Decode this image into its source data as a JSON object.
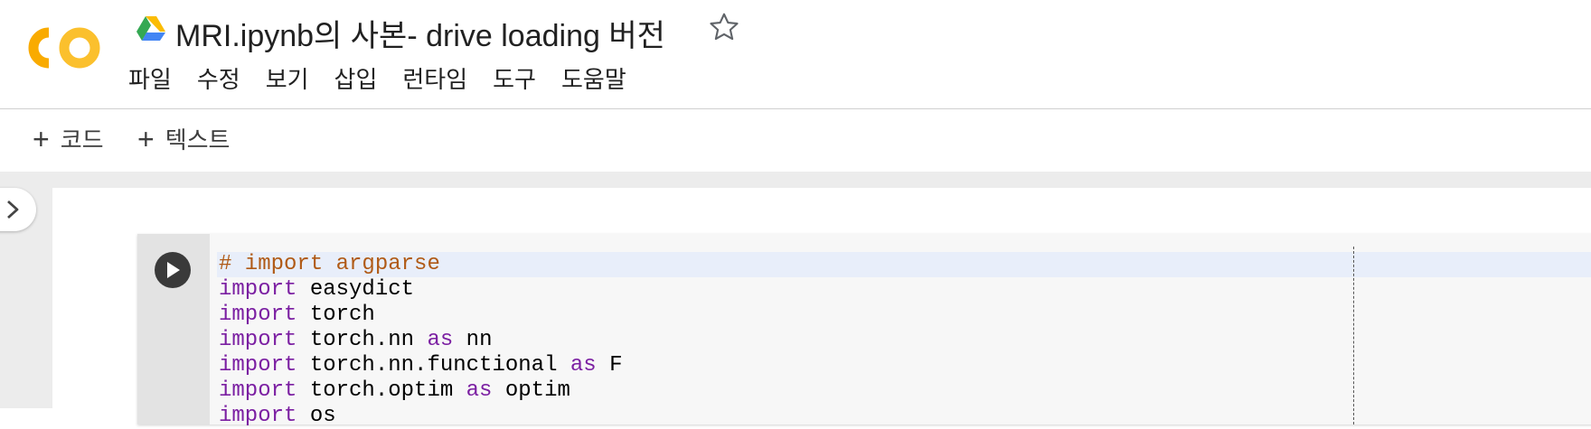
{
  "app": {
    "title": "MRI.ipynb의 사본- drive loading 버전",
    "logo_icon": "colab-logo-icon",
    "drive_icon": "google-drive-icon",
    "star_icon": "star-outline-icon"
  },
  "menu": {
    "items": [
      "파일",
      "수정",
      "보기",
      "삽입",
      "런타임",
      "도구",
      "도움말"
    ]
  },
  "toolbar": {
    "add_code_label": "코드",
    "add_text_label": "텍스트",
    "plus_glyph": "+"
  },
  "cell": {
    "run_icon": "play-icon",
    "lines": [
      {
        "segments": [
          {
            "t": "# import argparse",
            "c": "comment"
          }
        ],
        "active": true
      },
      {
        "segments": [
          {
            "t": "import",
            "c": "kw"
          },
          {
            "t": " easydict",
            "c": ""
          }
        ]
      },
      {
        "segments": [
          {
            "t": "import",
            "c": "kw"
          },
          {
            "t": " torch",
            "c": ""
          }
        ]
      },
      {
        "segments": [
          {
            "t": "import",
            "c": "kw"
          },
          {
            "t": " torch.nn ",
            "c": ""
          },
          {
            "t": "as",
            "c": "kw"
          },
          {
            "t": " nn",
            "c": ""
          }
        ]
      },
      {
        "segments": [
          {
            "t": "import",
            "c": "kw"
          },
          {
            "t": " torch.nn.functional ",
            "c": ""
          },
          {
            "t": "as",
            "c": "kw"
          },
          {
            "t": " F",
            "c": ""
          }
        ]
      },
      {
        "segments": [
          {
            "t": "import",
            "c": "kw"
          },
          {
            "t": " torch.optim ",
            "c": ""
          },
          {
            "t": "as",
            "c": "kw"
          },
          {
            "t": " optim",
            "c": ""
          }
        ]
      },
      {
        "segments": [
          {
            "t": "import",
            "c": "kw"
          },
          {
            "t": " os",
            "c": ""
          }
        ]
      }
    ]
  },
  "colors": {
    "keyword": "#7b1fa2",
    "comment": "#b05a16",
    "logo_orange": "#f9ab00",
    "logo_yellow": "#fbc02d"
  }
}
